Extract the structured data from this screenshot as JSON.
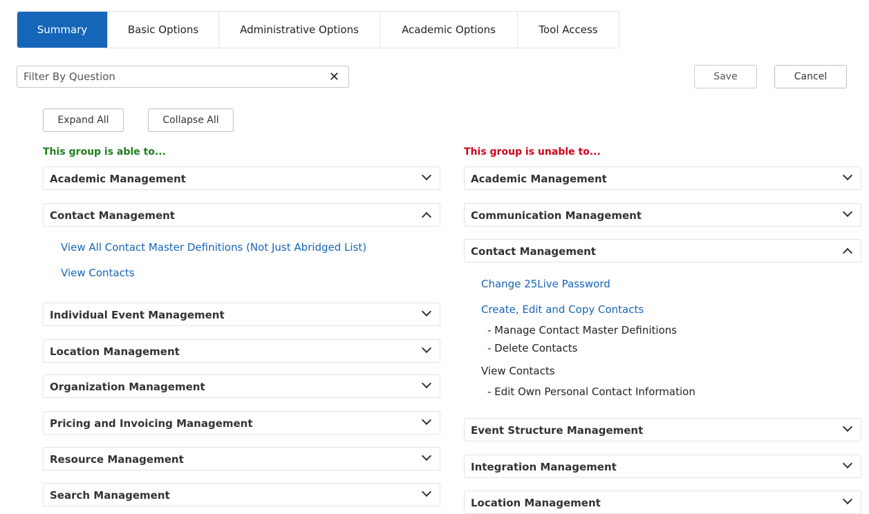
{
  "tabs": [
    {
      "label": "Summary",
      "active": true
    },
    {
      "label": "Basic Options"
    },
    {
      "label": "Administrative Options"
    },
    {
      "label": "Academic Options"
    },
    {
      "label": "Tool Access"
    }
  ],
  "filter": {
    "placeholder": "Filter By Question",
    "clear_icon": "close-icon"
  },
  "actions": {
    "save": "Save",
    "cancel": "Cancel"
  },
  "toggles": {
    "expand": "Expand All",
    "collapse": "Collapse All"
  },
  "left": {
    "title": "This group is able to...",
    "sections": [
      {
        "label": "Academic Management",
        "expanded": false
      },
      {
        "label": "Contact Management",
        "expanded": true,
        "items": [
          "View All Contact Master Definitions (Not Just Abridged List)",
          "View Contacts"
        ]
      },
      {
        "label": "Individual Event Management",
        "expanded": false
      },
      {
        "label": "Location Management",
        "expanded": false
      },
      {
        "label": "Organization Management",
        "expanded": false
      },
      {
        "label": "Pricing and Invoicing Management",
        "expanded": false
      },
      {
        "label": "Resource Management",
        "expanded": false
      },
      {
        "label": "Search Management",
        "expanded": false
      }
    ]
  },
  "right": {
    "title": "This group is unable to...",
    "sections": [
      {
        "label": "Academic Management",
        "expanded": false
      },
      {
        "label": "Communication Management",
        "expanded": false
      },
      {
        "label": "Contact Management",
        "expanded": true,
        "items": [
          {
            "text": "Change 25Live Password"
          },
          {
            "text": "Create, Edit and Copy Contacts",
            "sub": [
              "-  Manage Contact Master Definitions",
              "-  Delete Contacts"
            ]
          },
          {
            "text": "View Contacts",
            "sub": [
              "-  Edit Own Personal Contact Information"
            ]
          }
        ]
      },
      {
        "label": "Event Structure Management",
        "expanded": false
      },
      {
        "label": "Integration Management",
        "expanded": false
      },
      {
        "label": "Location Management",
        "expanded": false
      }
    ]
  },
  "colors": {
    "accent": "#1565b8",
    "able": "#1e7d1e",
    "unable": "#d0021b"
  }
}
